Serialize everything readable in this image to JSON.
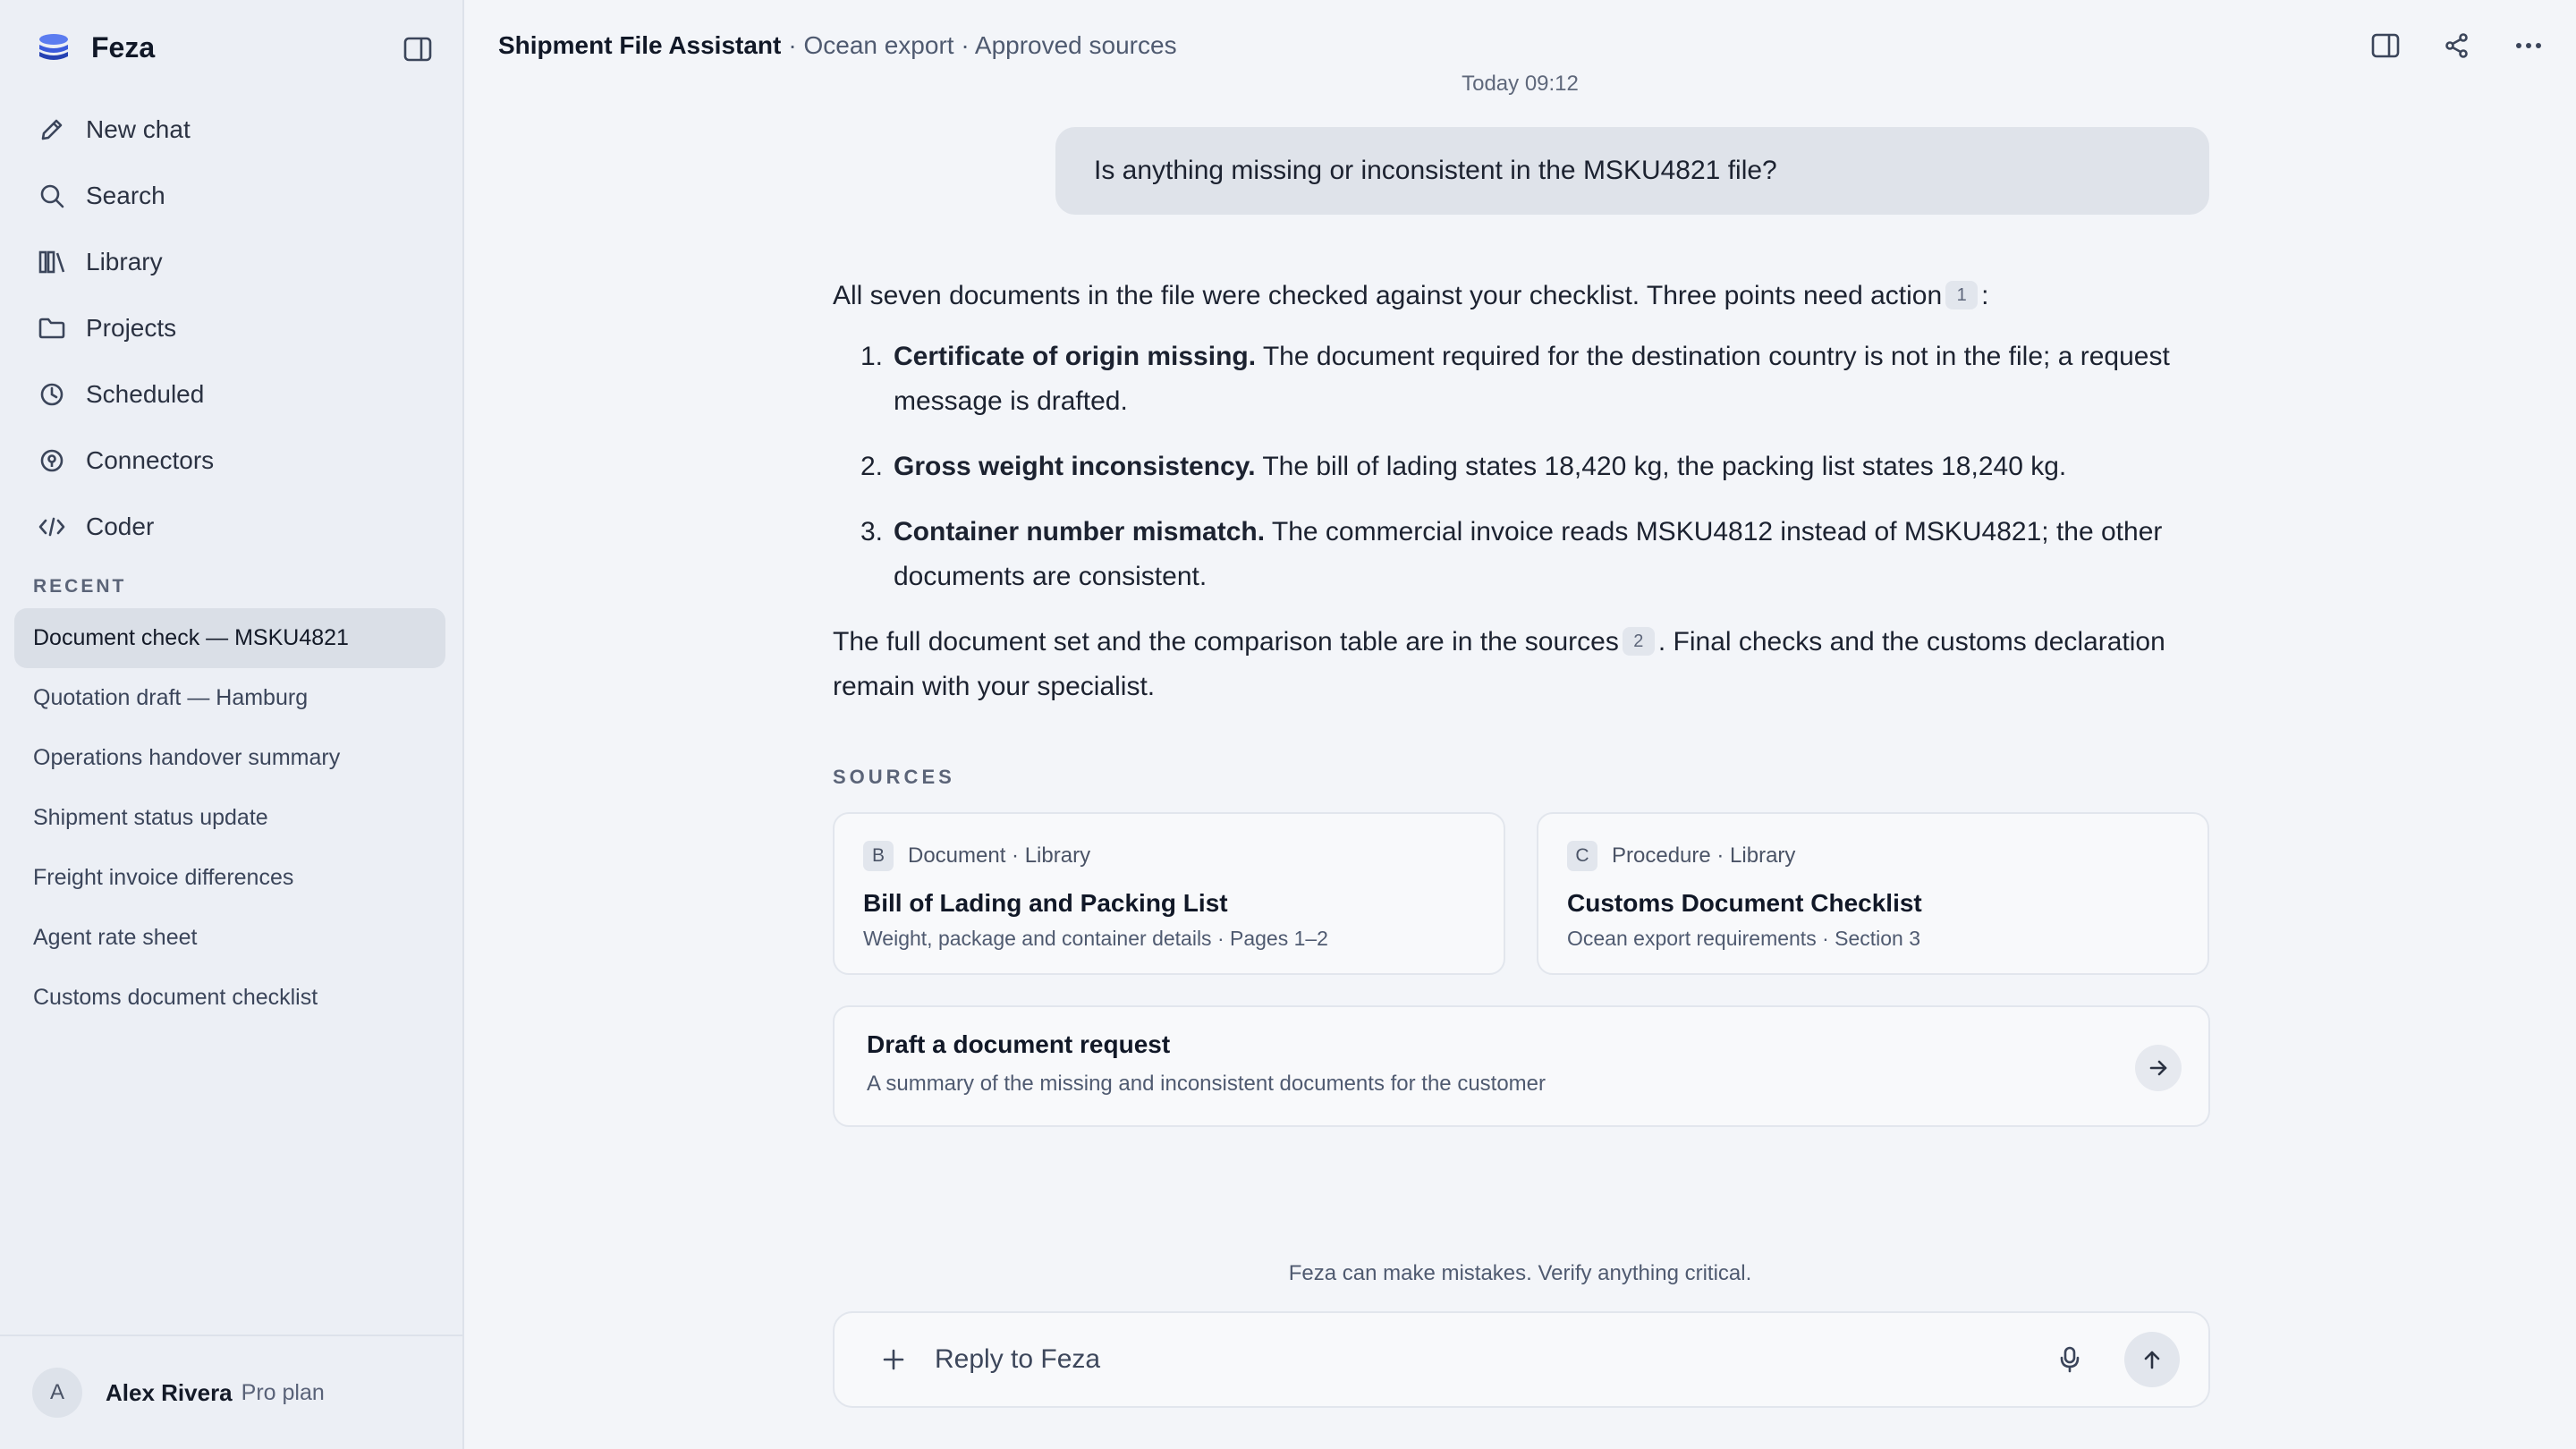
{
  "brand": {
    "name": "Feza"
  },
  "nav": [
    {
      "label": "New chat",
      "icon": "pencil-icon"
    },
    {
      "label": "Search",
      "icon": "search-icon"
    },
    {
      "label": "Library",
      "icon": "library-icon"
    },
    {
      "label": "Projects",
      "icon": "folder-icon"
    },
    {
      "label": "Scheduled",
      "icon": "clock-icon"
    },
    {
      "label": "Connectors",
      "icon": "connector-icon"
    },
    {
      "label": "Coder",
      "icon": "code-icon"
    }
  ],
  "recent": {
    "label": "RECENT",
    "items": [
      {
        "label": "Document check — MSKU4821",
        "active": true
      },
      {
        "label": "Quotation draft — Hamburg"
      },
      {
        "label": "Operations handover summary"
      },
      {
        "label": "Shipment status update"
      },
      {
        "label": "Freight invoice differences"
      },
      {
        "label": "Agent rate sheet"
      },
      {
        "label": "Customs document checklist"
      }
    ]
  },
  "user": {
    "initial": "A",
    "name": "Alex Rivera",
    "plan": "Pro plan"
  },
  "header": {
    "title": "Shipment File Assistant",
    "subtitle": "· Ocean export · Approved sources"
  },
  "chat": {
    "timestamp": "Today 09:12",
    "user_message": "Is anything missing or inconsistent in the MSKU4821 file?",
    "answer": {
      "intro": "All seven documents in the file were checked against your checklist. Three points need action",
      "intro_cite": "1",
      "intro_end": ":",
      "items": [
        {
          "num": "1.",
          "title": "Certificate of origin missing.",
          "text": " The document required for the destination country is not in the file; a request message is drafted."
        },
        {
          "num": "2.",
          "title": "Gross weight inconsistency.",
          "text": " The bill of lading states 18,420 kg, the packing list states 18,240 kg."
        },
        {
          "num": "3.",
          "title": "Container number mismatch.",
          "text": " The commercial invoice reads MSKU4812 instead of MSKU4821; the other documents are consistent."
        }
      ],
      "outro_start": "The full document set and the comparison table are in the sources",
      "outro_cite": "2",
      "outro_end": ". Final checks and the customs declaration remain with your specialist."
    },
    "sources_label": "SOURCES",
    "sources": [
      {
        "badge": "B",
        "meta": "Document · Library",
        "title": "Bill of Lading and Packing List",
        "desc": "Weight, package and container details · Pages 1–2"
      },
      {
        "badge": "C",
        "meta": "Procedure · Library",
        "title": "Customs Document Checklist",
        "desc": "Ocean export requirements · Section 3"
      }
    ],
    "action": {
      "title": "Draft a document request",
      "desc": "A summary of the missing and inconsistent documents for the customer"
    }
  },
  "footer": {
    "disclaimer": "Feza can make mistakes. Verify anything critical.",
    "placeholder": "Reply to Feza"
  },
  "colors": {
    "brand": "#3b5bdb",
    "sidebar_bg": "#eceff5",
    "main_bg": "#f3f5f9",
    "active_item": "#dadfe7"
  }
}
